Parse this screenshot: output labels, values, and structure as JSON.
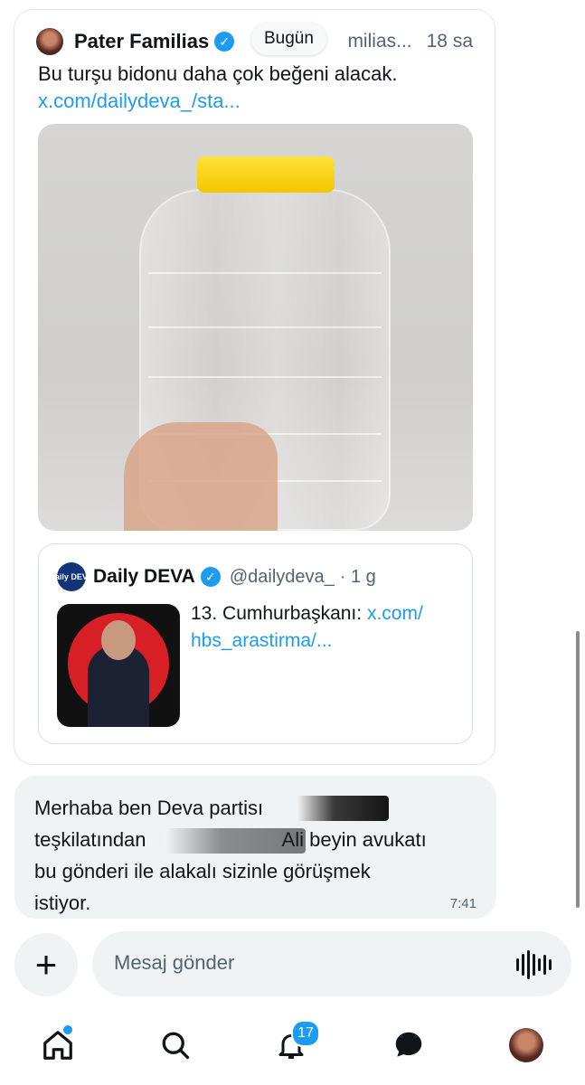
{
  "post": {
    "author": "Pater Familias",
    "handle": "milias...",
    "time": "18 sa",
    "date_pill": "Bugün",
    "text": "Bu turşu bidonu daha çok beğeni alacak.",
    "link": "x.com/dailydeva_/sta..."
  },
  "quote": {
    "avatar_text": "daily DEVA",
    "author": "Daily DEVA",
    "handle": "@dailydeva_",
    "time": "· 1 g",
    "text": "13. Cumhurbaşkanı:",
    "link1": "x.com/",
    "link2": "hbs_arastirma/..."
  },
  "message": {
    "line1": "Merhaba ben Deva partisı",
    "line2a": "teşkilatından",
    "line2b": "Ali beyin avukatı",
    "line3": "bu gönderi ile alakalı sizinle görüşmek",
    "line4": "istiyor.",
    "time": "7:41"
  },
  "composer": {
    "placeholder": "Mesaj gönder"
  },
  "nav": {
    "notifications_count": "17"
  },
  "colors": {
    "accent": "#1d9bf0",
    "bubble": "#eff3f4",
    "lid": "#f5cd00"
  }
}
